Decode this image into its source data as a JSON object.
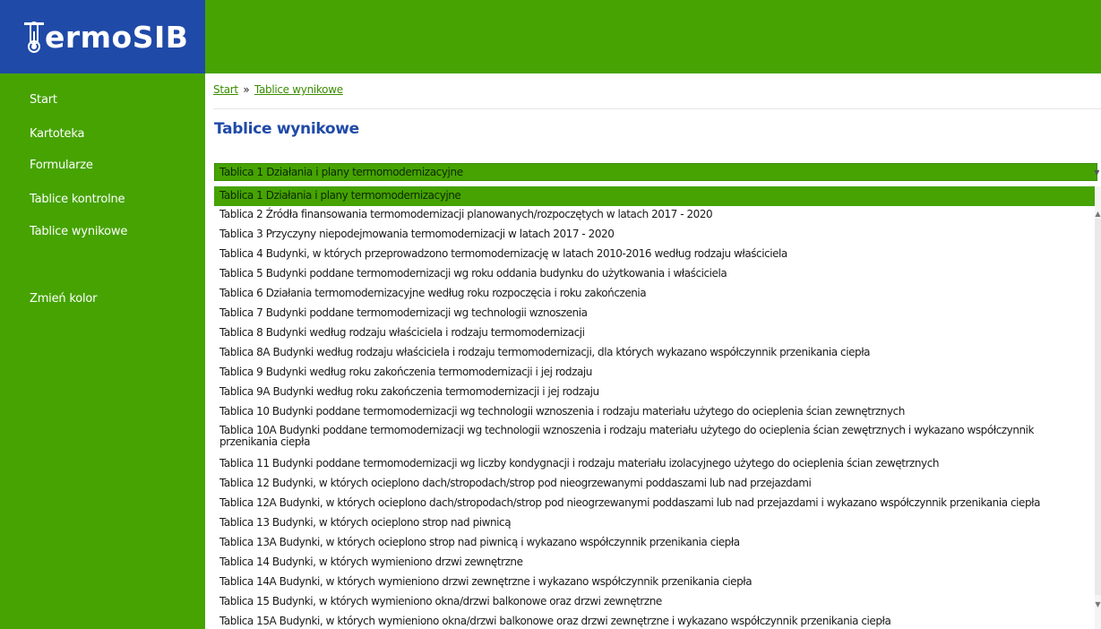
{
  "logo": {
    "text": "ermoSIB",
    "icon": "thermometer-icon"
  },
  "sidebar": {
    "items": [
      {
        "label": "Start"
      },
      {
        "label": "Kartoteka"
      },
      {
        "label": "Formularze"
      },
      {
        "label": "Tablice kontrolne"
      },
      {
        "label": "Tablice wynikowe"
      },
      {
        "label": "Zmień kolor"
      }
    ]
  },
  "breadcrumb": {
    "start": "Start",
    "separator": "»",
    "current": "Tablice wynikowe"
  },
  "page_title": "Tablice wynikowe",
  "select": {
    "value": "Tablica 1 Działania i plany termomodernizacyjne",
    "options": [
      "Tablica 1 Działania i plany termomodernizacyjne",
      "Tablica 2 Źródła finansowania termomodernizacji planowanych/rozpoczętych w latach 2017 - 2020",
      "Tablica 3 Przyczyny niepodejmowania termomodernizacji w latach 2017 - 2020",
      "Tablica 4 Budynki, w których przeprowadzono termomodernizację w latach 2010-2016 według rodzaju właściciela",
      "Tablica 5 Budynki poddane termomodernizacji wg roku oddania budynku do użytkowania i właściciela",
      "Tablica 6 Działania termomodernizacyjne według roku rozpoczęcia i roku zakończenia",
      "Tablica 7 Budynki poddane termomodernizacji wg technologii wznoszenia",
      "Tablica 8 Budynki według rodzaju właściciela i rodzaju termomodernizacji",
      "Tablica 8A Budynki według rodzaju właściciela i rodzaju termomodernizacji, dla których wykazano współczynnik przenikania ciepła",
      "Tablica 9 Budynki według roku zakończenia termomodernizacji i jej rodzaju",
      "Tablica 9A Budynki według roku zakończenia termomodernizacji i jej rodzaju",
      "Tablica 10 Budynki poddane termomodernizacji wg technologii wznoszenia i rodzaju materiału użytego do ocieplenia ścian zewnętrznych",
      "Tablica 10A Budynki poddane termomodernizacji wg technologii wznoszenia i rodzaju materiału użytego do ocieplenia ścian zewętrznych i wykazano współczynnik przenikania ciepła",
      "Tablica 11 Budynki poddane termomodernizacji wg liczby kondygnacji i rodzaju materiału izolacyjnego użytego do ocieplenia ścian zewętrznych",
      "Tablica 12 Budynki, w których ocieplono dach/stropodach/strop pod nieogrzewanymi poddaszami lub nad przejazdami",
      "Tablica 12A Budynki, w których ocieplono dach/stropodach/strop pod nieogrzewanymi poddaszami lub nad przejazdami i wykazano współczynnik przenikania ciepła",
      "Tablica 13 Budynki, w których ocieplono strop nad piwnicą",
      "Tablica 13A Budynki, w których ocieplono strop nad piwnicą i wykazano współczynnik przenikania ciepła",
      "Tablica 14 Budynki, w których wymieniono drzwi zewnętrzne",
      "Tablica 14A Budynki, w których wymieniono drzwi zewnętrzne i wykazano współczynnik przenikania ciepła",
      "Tablica 15 Budynki, w których wymieniono okna/drzwi balkonowe oraz drzwi zewnętrzne",
      "Tablica 15A Budynki, w których wymieniono okna/drzwi balkonowe oraz drzwi zewnętrzne i wykazano współczynnik przenikania ciepła"
    ]
  },
  "colors": {
    "green": "#46a302",
    "blue": "#1f4aa8",
    "link": "#3a8c00"
  }
}
